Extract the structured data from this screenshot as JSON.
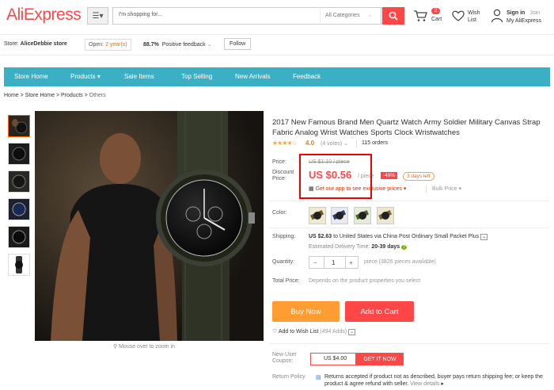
{
  "header": {
    "logo": "AliExpress",
    "search_placeholder": "I'm shopping for...",
    "category": "All Categories",
    "cart_count": "2",
    "cart_label": "Cart",
    "wish_line1": "Wish",
    "wish_line2": "List",
    "signin": "Sign in",
    "join": "Join",
    "myaliexpress": "My AliExpress"
  },
  "store": {
    "label": "Store:",
    "name": "AliceDebbie store",
    "open_prefix": "Open:",
    "open_years": "2 year(s)",
    "feedback_pct": "88.7%",
    "feedback_label": "Positive feedback",
    "follow": "Follow"
  },
  "nav": [
    "Store Home",
    "Products",
    "Sale Items",
    "Top Selling",
    "New Arrivals",
    "Feedback"
  ],
  "breadcrumb": [
    "Home",
    "Store Home",
    "Products",
    "Others"
  ],
  "product": {
    "title": "2017 New Famous Brand Men Quartz Watch Army Soldier Military Canvas Strap Fabric Analog Wrist Watches Sports Clock Wristwatches",
    "rating": "4.0",
    "votes": "(4 votes)",
    "orders": "115 orders",
    "price_label": "Price:",
    "old_price": "US $1.10 / piece",
    "discount_label": "Discount Price:",
    "price": "US $0.56",
    "unit": "/ piece",
    "discount": "-49%",
    "days_left": "3 days left",
    "app_offer": "Get our app to see exclusive prices",
    "bulk": "Bulk Price",
    "color_label": "Color:",
    "shipping_label": "Shipping:",
    "ship_price": "US $2.63",
    "ship_text": "to United States via China Post Ordinary Small Packet Plus",
    "delivery_label": "Estimated Delivery Time:",
    "delivery_days": "20-39 days",
    "quantity_label": "Quantity:",
    "quantity": "1",
    "minus": "−",
    "plus": "+",
    "availability": "piece (3826 pieces available)",
    "total_label": "Total Price:",
    "total_text": "Depends on the product properties you select",
    "buy_now": "Buy Now",
    "add_to_cart": "Add to Cart",
    "add_wish": "Add to Wish List",
    "wish_count": "(494 Adds)",
    "coupon_label": "New User Coupon:",
    "coupon_value": "US $4.00",
    "coupon_button": "GET IT NOW",
    "return_label": "Return Policy",
    "return_text": "Returns accepted if product not as described, buyer pays return shipping fee; or keep the product & agree refund with seller.",
    "view_details": "View details",
    "zoom_hint": "Mouse over to zoom in"
  },
  "colors": {
    "accent": "#ff4747",
    "nav": "#3bafc4",
    "orange": "#ff9c33"
  }
}
